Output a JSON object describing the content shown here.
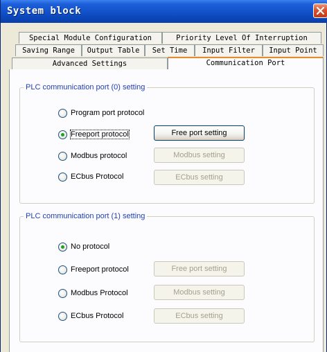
{
  "window": {
    "title": "System block"
  },
  "tabs": {
    "row1": [
      "Special Module Configuration",
      "Priority Level Of Interruption"
    ],
    "row2": [
      "Saving Range",
      "Output Table",
      "Set Time",
      "Input Filter",
      "Input Point"
    ],
    "row3": [
      "Advanced Settings",
      "Communication Port"
    ]
  },
  "port0": {
    "legend": "PLC communication port (0) setting",
    "options": [
      {
        "label": "Program port protocol",
        "checked": false
      },
      {
        "label": "Freeport protocol",
        "checked": true
      },
      {
        "label": "Modbus protocol",
        "checked": false
      },
      {
        "label": "ECbus Protocol",
        "checked": false
      }
    ],
    "buttons": [
      {
        "label": "Free port setting",
        "enabled": true
      },
      {
        "label": "Modbus setting",
        "enabled": false
      },
      {
        "label": "ECbus setting",
        "enabled": false
      }
    ]
  },
  "port1": {
    "legend": "PLC communication port (1) setting",
    "options": [
      {
        "label": "No protocol",
        "checked": true
      },
      {
        "label": "Freeport protocol",
        "checked": false
      },
      {
        "label": "Modbus Protocol",
        "checked": false
      },
      {
        "label": "ECbus Protocol",
        "checked": false
      }
    ],
    "buttons": [
      {
        "label": "Free port setting",
        "enabled": false
      },
      {
        "label": "Modbus setting",
        "enabled": false
      },
      {
        "label": "ECbus setting",
        "enabled": false
      }
    ]
  },
  "colors": {
    "titlebar": "#1150c8",
    "active_tab_accent": "#e68b2c",
    "group_legend": "#1f3fb8",
    "radio_checked": "#21a121",
    "disabled_text": "#a3a08f"
  },
  "icons": {
    "close": "close-icon"
  }
}
